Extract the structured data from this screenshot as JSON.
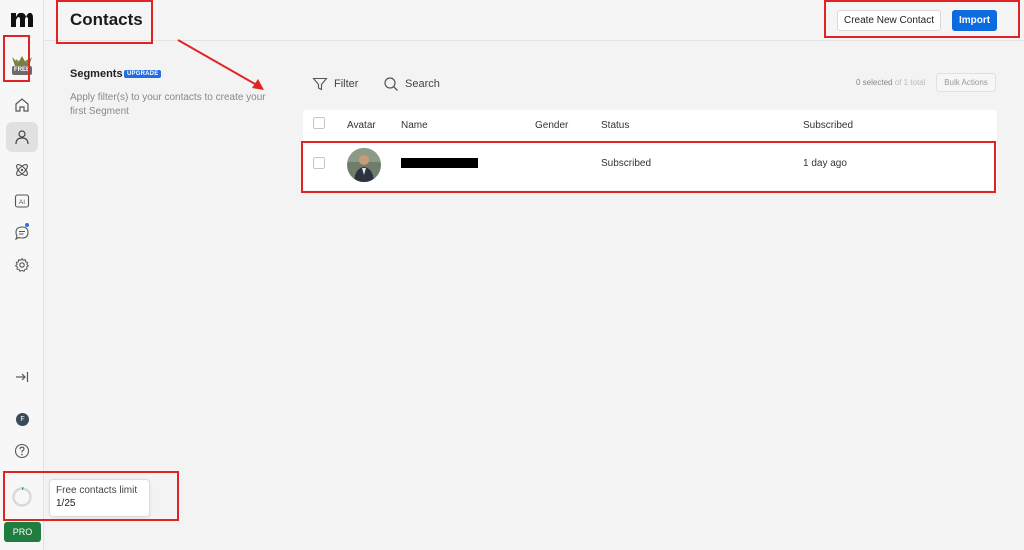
{
  "header": {
    "title": "Contacts",
    "create_button": "Create New Contact",
    "import_button": "Import"
  },
  "sidebar": {
    "badge": "FREE",
    "user_initial": "F",
    "pro_label": "PRO",
    "items": [
      {
        "name": "home",
        "icon": "home-icon"
      },
      {
        "name": "contacts",
        "icon": "user-icon",
        "active": true
      },
      {
        "name": "integrations",
        "icon": "atom-icon"
      },
      {
        "name": "ai",
        "icon": "ai-icon"
      },
      {
        "name": "messages",
        "icon": "chat-icon"
      },
      {
        "name": "settings",
        "icon": "gear-icon"
      }
    ]
  },
  "tooltip": {
    "line1": "Free contacts limit",
    "line2": "1/25"
  },
  "segments": {
    "title": "Segments",
    "badge": "UPGRADE",
    "description": "Apply filter(s) to your contacts to create your first Segment"
  },
  "toolbar": {
    "filter_label": "Filter",
    "search_label": "Search",
    "selected_count": "0 selected",
    "total": "of 1 total",
    "bulk_actions": "Bulk Actions"
  },
  "table": {
    "columns": [
      "Avatar",
      "Name",
      "Gender",
      "Status",
      "Subscribed"
    ],
    "rows": [
      {
        "status": "Subscribed",
        "subscribed": "1 day ago"
      }
    ]
  },
  "colors": {
    "accent": "#0d6be0",
    "pro": "#1f7d3f",
    "annotation": "#e02424"
  }
}
